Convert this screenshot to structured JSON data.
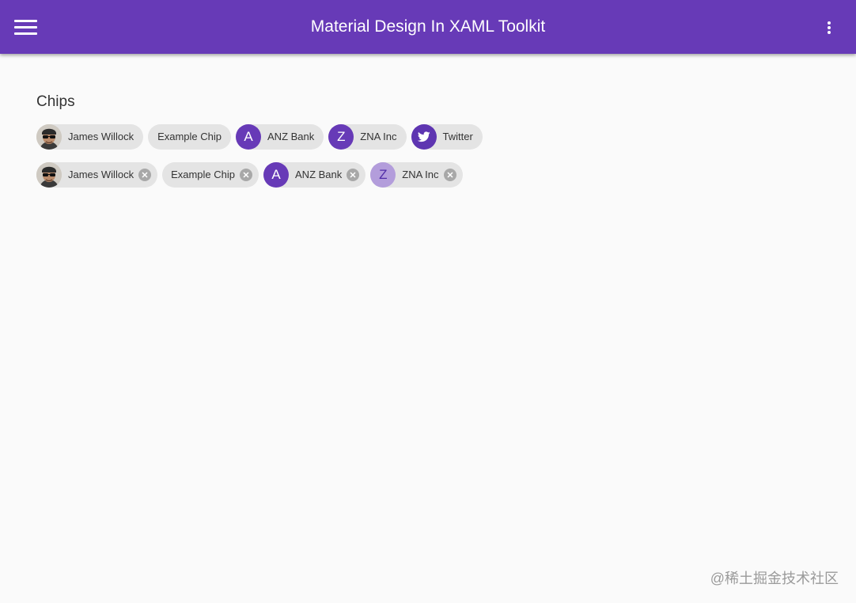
{
  "appbar": {
    "title": "Material Design In XAML Toolkit",
    "menu_icon": "hamburger-menu-icon",
    "more_icon": "dots-vertical-icon",
    "color": "#673ab7"
  },
  "chips_section": {
    "title": "Chips",
    "row1": [
      {
        "label": "James Willock",
        "avatar": "photo"
      },
      {
        "label": "Example Chip"
      },
      {
        "label": "ANZ Bank",
        "avatar_letter": "A"
      },
      {
        "label": "ZNA Inc",
        "avatar_letter": "Z"
      },
      {
        "label": "Twitter",
        "avatar_icon": "twitter-bird-icon"
      }
    ],
    "row2": [
      {
        "label": "James Willock",
        "avatar": "photo",
        "deletable": true
      },
      {
        "label": "Example Chip",
        "deletable": true
      },
      {
        "label": "ANZ Bank",
        "avatar_letter": "A",
        "deletable": true
      },
      {
        "label": "ZNA Inc",
        "avatar_letter": "Z",
        "deletable": true
      }
    ],
    "delete_icon": "close-circle-icon",
    "chip_color": "#e4e4e4",
    "avatar_color": "#673ab7",
    "avatar_light_color": "#b39ddb"
  },
  "watermark": {
    "text": "@稀土掘金技术社区"
  }
}
